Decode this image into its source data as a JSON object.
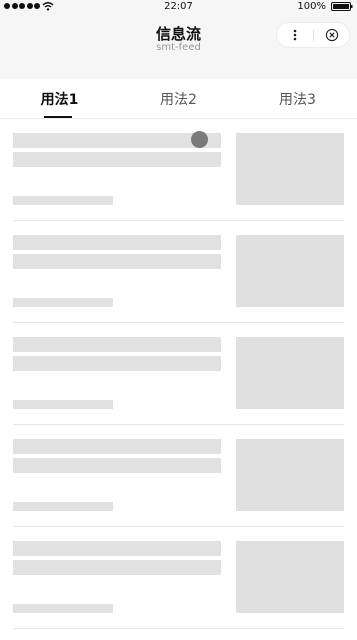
{
  "status_bar": {
    "time": "22:07",
    "battery": "100%"
  },
  "header": {
    "title": "信息流",
    "subtitle": "smt-feed"
  },
  "tabs": [
    {
      "label": "用法1",
      "active": true
    },
    {
      "label": "用法2",
      "active": false
    },
    {
      "label": "用法3",
      "active": false
    }
  ],
  "icons": {
    "signal": "signal-dots-icon",
    "wifi": "wifi-icon",
    "battery": "battery-icon",
    "more": "more-icon",
    "close": "close-circle-icon"
  },
  "colors": {
    "skeleton": "#e1e1e1",
    "header_bg": "#f6f6f6",
    "active_tab": "#111111",
    "inactive_tab": "#555555"
  },
  "feed": {
    "item_count": 5
  }
}
